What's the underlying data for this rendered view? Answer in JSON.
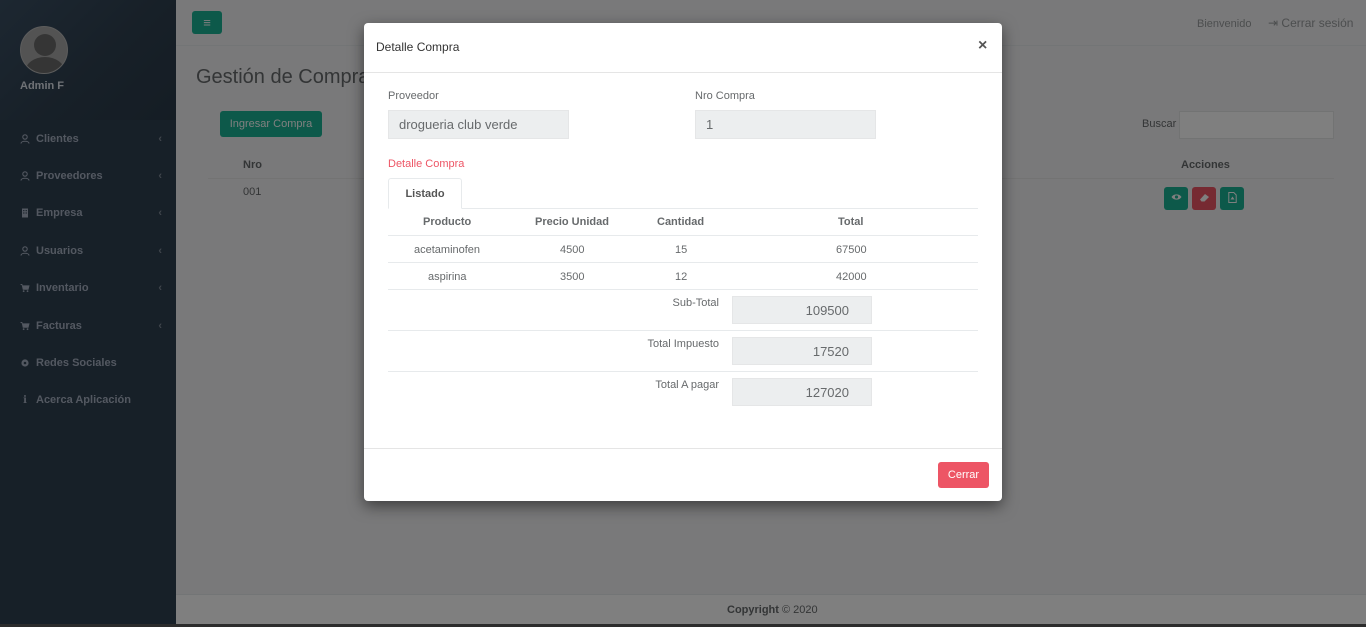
{
  "sidebar": {
    "user_name": "Admin F",
    "items": [
      {
        "label": "Clientes",
        "icon": "user-icon"
      },
      {
        "label": "Proveedores",
        "icon": "user-icon"
      },
      {
        "label": "Empresa",
        "icon": "building-icon"
      },
      {
        "label": "Usuarios",
        "icon": "user-icon"
      },
      {
        "label": "Inventario",
        "icon": "cart-icon"
      },
      {
        "label": "Facturas",
        "icon": "cart-icon"
      },
      {
        "label": "Redes Sociales",
        "icon": "gear-icon"
      },
      {
        "label": "Acerca Aplicación",
        "icon": "info-icon"
      }
    ]
  },
  "header": {
    "welcome": "Bienvenido",
    "logout": "Cerrar sesión"
  },
  "page": {
    "title": "Gestión de Compras",
    "add_button": "Ingresar Compra",
    "search_label": "Buscar",
    "search_value": "",
    "table": {
      "col_nro": "Nro",
      "col_acciones": "Acciones",
      "rows": [
        {
          "nro": "001"
        }
      ]
    }
  },
  "footer": {
    "copyright_label": "Copyright",
    "copyright_rest": "© 2020"
  },
  "modal": {
    "title": "Detalle Compra",
    "close_symbol": "×",
    "proveedor_label": "Proveedor",
    "proveedor_value": "drogueria club verde",
    "nro_label": "Nro Compra",
    "nro_value": "1",
    "section_title": "Detalle Compra",
    "tab_label": "Listado",
    "columns": [
      "Producto",
      "Precio Unidad",
      "Cantidad",
      "Total"
    ],
    "items": [
      {
        "producto": "acetaminofen",
        "precio": "4500",
        "cantidad": "15",
        "total": "67500"
      },
      {
        "producto": "aspirina",
        "precio": "3500",
        "cantidad": "12",
        "total": "42000"
      }
    ],
    "subtotal_label": "Sub-Total",
    "subtotal_value": "109500",
    "impuesto_label": "Total Impuesto",
    "impuesto_value": "17520",
    "pagar_label": "Total A pagar",
    "pagar_value": "127020",
    "cerrar_button": "Cerrar"
  },
  "colors": {
    "primary": "#1ab394",
    "danger": "#ed5565",
    "sidebar": "#2f4050"
  }
}
